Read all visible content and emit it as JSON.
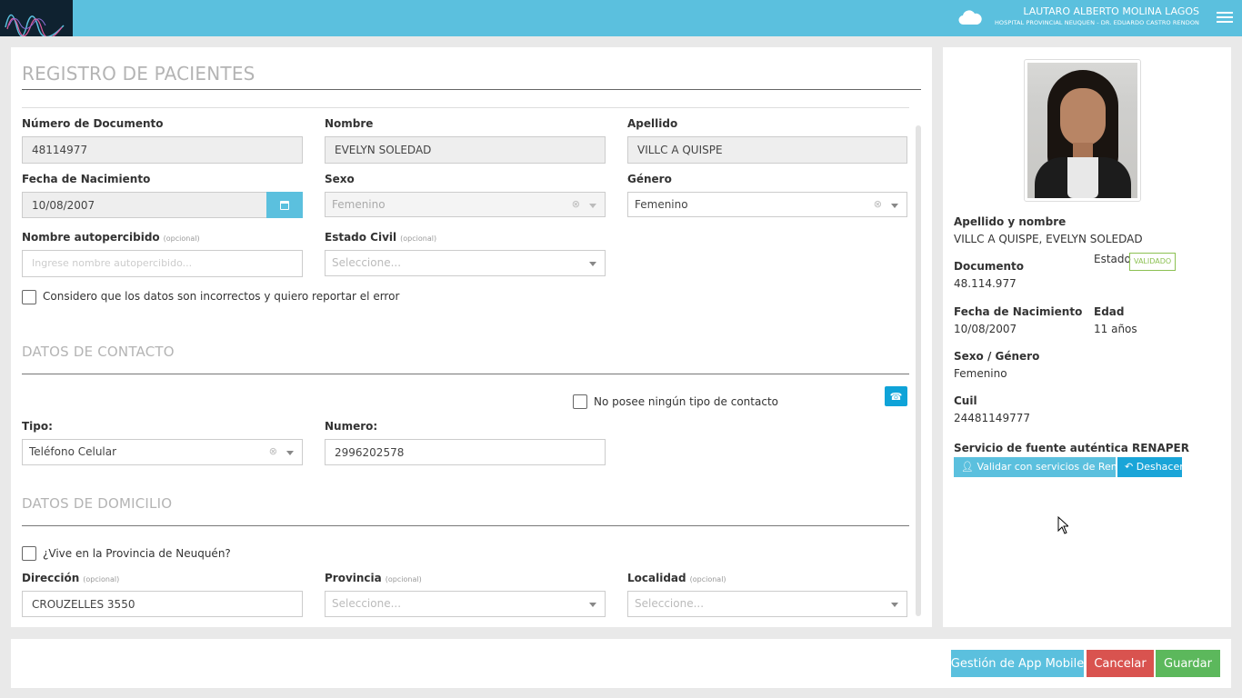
{
  "header": {
    "user_name": "LAUTARO ALBERTO MOLINA LAGOS",
    "hospital": "HOSPITAL PROVINCIAL NEUQUEN - DR. EDUARDO CASTRO RENDON"
  },
  "form": {
    "title": "REGISTRO DE PACIENTES",
    "optional": "(opcional)",
    "documento": {
      "label": "Número de Documento",
      "value": "48114977"
    },
    "nombre": {
      "label": "Nombre",
      "value": "EVELYN SOLEDAD"
    },
    "apellido": {
      "label": "Apellido",
      "value": "VILLC A QUISPE"
    },
    "fecha_nacimiento": {
      "label": "Fecha de Nacimiento",
      "value": "10/08/2007"
    },
    "sexo": {
      "label": "Sexo",
      "value": "Femenino"
    },
    "genero": {
      "label": "Género",
      "value": "Femenino"
    },
    "nombre_autopercibido": {
      "label": "Nombre autopercibido",
      "placeholder": "Ingrese nombre autopercibido..."
    },
    "estado_civil": {
      "label": "Estado Civil",
      "placeholder": "Seleccione..."
    },
    "report_error": "Considero que los datos son incorrectos y quiero reportar el error",
    "contacto": {
      "title": "DATOS DE CONTACTO",
      "no_contact": "No posee ningún tipo de contacto",
      "tipo_label": "Tipo:",
      "tipo_value": "Teléfono Celular",
      "numero_label": "Numero:",
      "numero_value": "2996202578"
    },
    "domicilio": {
      "title": "DATOS DE DOMICILIO",
      "vive_neuquen": "¿Vive en la Provincia de Neuquén?",
      "direccion_label": "Dirección",
      "direccion_value": "CROUZELLES 3550",
      "provincia_label": "Provincia",
      "provincia_placeholder": "Seleccione...",
      "localidad_label": "Localidad",
      "localidad_placeholder": "Seleccione..."
    }
  },
  "summary": {
    "nombre_label": "Apellido y nombre",
    "nombre_value": "VILLC A QUISPE, EVELYN SOLEDAD",
    "documento_label": "Documento",
    "documento_value": "48.114.977",
    "estado_label": "Estado",
    "estado_badge": "VALIDADO",
    "fecha_label": "Fecha de Nacimiento",
    "fecha_value": "10/08/2007",
    "edad_label": "Edad",
    "edad_value": "11 años",
    "sexo_label": "Sexo / Género",
    "sexo_value": "Femenino",
    "cuil_label": "Cuil",
    "cuil_value": "24481149777",
    "renaper_label": "Servicio de fuente auténtica RENAPER",
    "validar_button": "Validar con servicios de Renaper",
    "deshacer_button": "Deshacer"
  },
  "footer": {
    "app_mobile": "Gestión de App Mobile",
    "cancelar": "Cancelar",
    "guardar": "Guardar"
  },
  "colors": {
    "primary": "#5bc0de",
    "danger": "#d9534f",
    "success": "#5cb85c",
    "validated": "#8cc152"
  }
}
